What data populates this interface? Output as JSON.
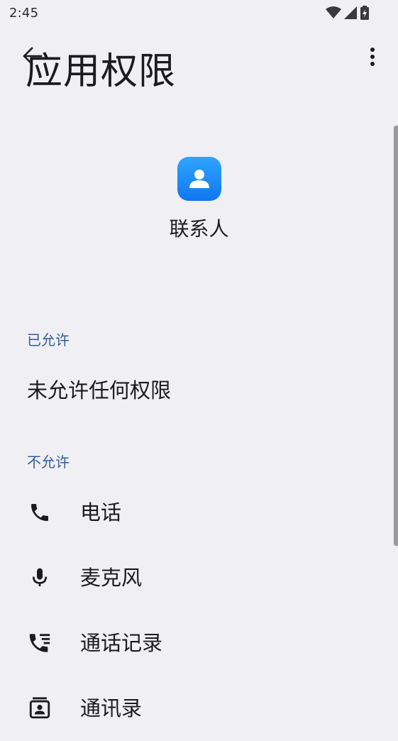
{
  "status_bar": {
    "time": "2:45",
    "icons": [
      "wifi-icon",
      "cell-signal-icon",
      "battery-charging-icon"
    ]
  },
  "app_bar": {
    "title": "应用权限",
    "back_icon": "back-arrow-icon",
    "menu_icon": "more-vert-icon"
  },
  "app": {
    "name": "联系人",
    "icon": "contacts-app-icon",
    "icon_color": "#1a8cff"
  },
  "sections": {
    "allowed": {
      "header": "已允许",
      "empty_text": "未允许任何权限"
    },
    "denied": {
      "header": "不允许",
      "items": [
        {
          "label": "电话",
          "icon": "phone-icon"
        },
        {
          "label": "麦克风",
          "icon": "microphone-icon"
        },
        {
          "label": "通话记录",
          "icon": "call-log-icon"
        },
        {
          "label": "通讯录",
          "icon": "contacts-icon"
        }
      ]
    }
  },
  "colors": {
    "background": "#f0eff4",
    "section_header": "#2f5e9c",
    "text": "#1b1b1f"
  }
}
